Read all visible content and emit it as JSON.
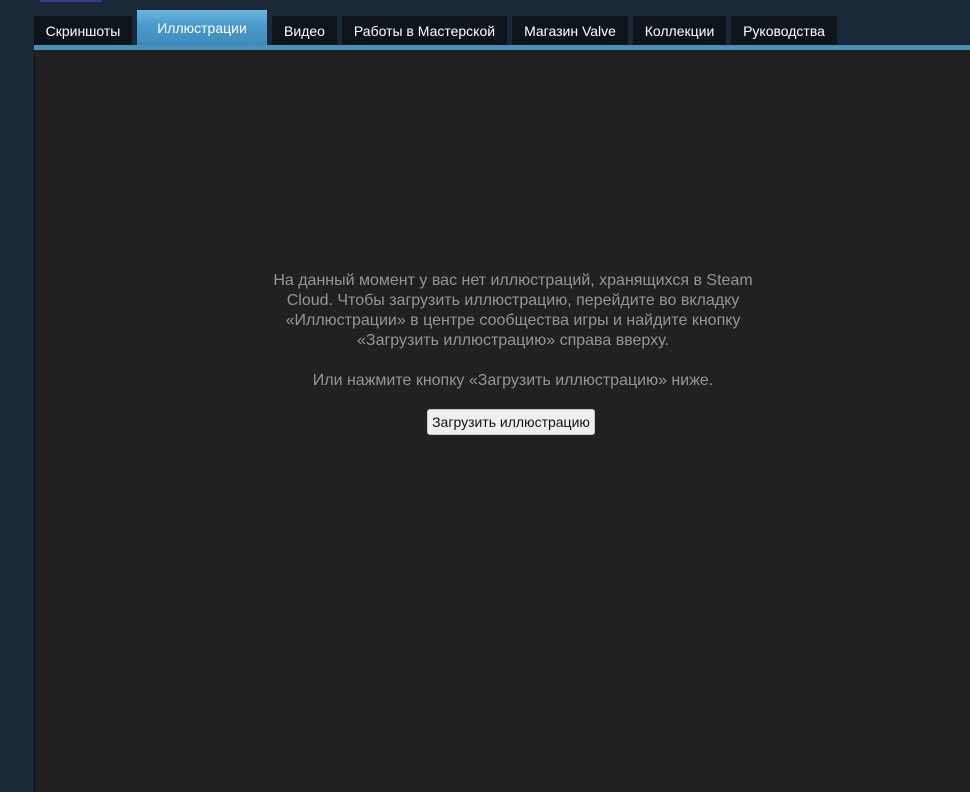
{
  "tabs": [
    {
      "label": "Скриншоты",
      "active": false
    },
    {
      "label": "Иллюстрации",
      "active": true
    },
    {
      "label": "Видео",
      "active": false
    },
    {
      "label": "Работы в Мастерской",
      "active": false
    },
    {
      "label": "Магазин Valve",
      "active": false
    },
    {
      "label": "Коллекции",
      "active": false
    },
    {
      "label": "Руководства",
      "active": false
    }
  ],
  "empty_state": {
    "message_lines": [
      "На данный момент у вас нет иллюстраций, хранящихся в Steam",
      "Cloud. Чтобы загрузить иллюстрацию, перейдите во вкладку",
      "«Иллюстрации» в центре сообщества игры и найдите кнопку",
      "«Загрузить иллюстрацию» справа вверху."
    ],
    "alt_message": "Или нажмите кнопку «Загрузить иллюстрацию» ниже.",
    "upload_button_label": "Загрузить иллюстрацию"
  },
  "colors": {
    "page_background": "#1b2838",
    "tab_background": "#0e141b",
    "tab_active": "#4a9bcb",
    "content_background": "#212121",
    "message_text": "#959595",
    "button_background": "#efefef"
  }
}
